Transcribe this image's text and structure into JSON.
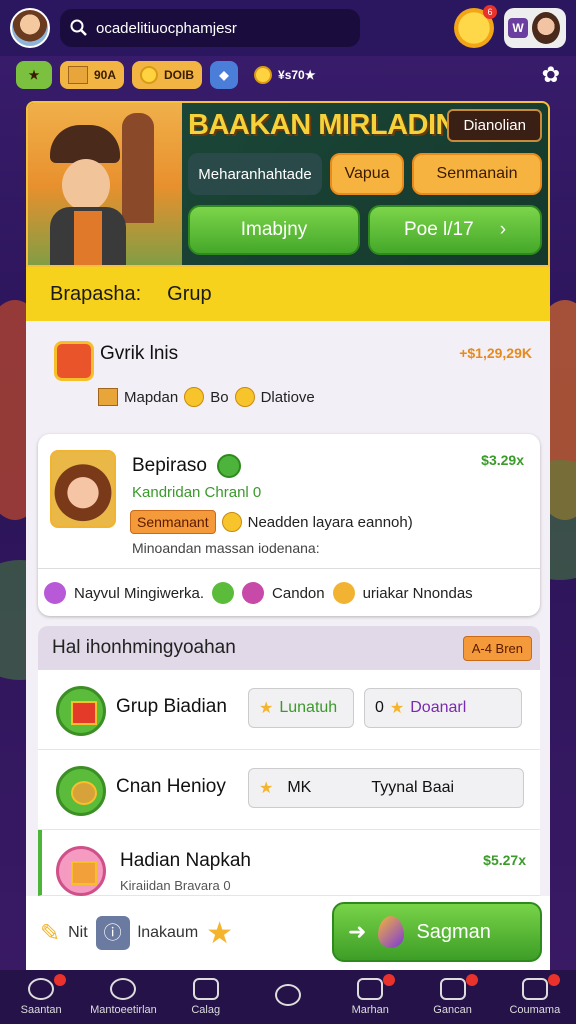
{
  "search": {
    "text": "ocadelitiuocphamjesr"
  },
  "resources": {
    "item1": "90A",
    "item2": "DOIB",
    "item3": "¥s70★"
  },
  "hero": {
    "title": "BAAKAN MIRLADIN",
    "tag": "Dianolian",
    "btn_dark": "Meharanhahtade",
    "btn_orange1": "Vapua",
    "btn_orange2": "Senmanain",
    "btn_green1": "Imabjny",
    "btn_green2": "Poe l/17"
  },
  "strip": {
    "label": "Brapasha:",
    "value": "Grup"
  },
  "row1": {
    "title": "Gvrik lnis",
    "amount": "+$1,29,29K",
    "sub1": "Mapdan",
    "sub2": "Bo",
    "sub3": "Dlatiove"
  },
  "card": {
    "name": "Bepiraso",
    "amount": "$3.29x",
    "subtitle": "Kandridan Chranl 0",
    "pill": "Senmanant",
    "detail": "Neadden layara eannoh)",
    "note": "Minoandan massan iodenana:",
    "bottom1": "Nayvul Mingiwerka.",
    "bottom2": "Candon",
    "bottom3": "uriakar Nnondas"
  },
  "section": {
    "title": "Hal ihonhmingyoahan",
    "tag": "A-4 Bren"
  },
  "list": [
    {
      "title": "Grup Biadian",
      "pill1": "Lunatuh",
      "pill2_prefix": "0",
      "pill2": "Doanarl"
    },
    {
      "title": "Cnan Henioy",
      "pill1": "MK",
      "pill2": "Tyynal Baai"
    },
    {
      "title": "Hadian Napkah",
      "sub": "Kiraiidan Bravara 0",
      "amount": "$5.27x"
    }
  ],
  "action": {
    "label1": "Nit",
    "label2": "lnakaum",
    "btn": "Sagman"
  },
  "nav": [
    "Saantan",
    "Mantoeetirlan",
    "Calag",
    "",
    "Marhan",
    "Gancan",
    "Coumama"
  ]
}
